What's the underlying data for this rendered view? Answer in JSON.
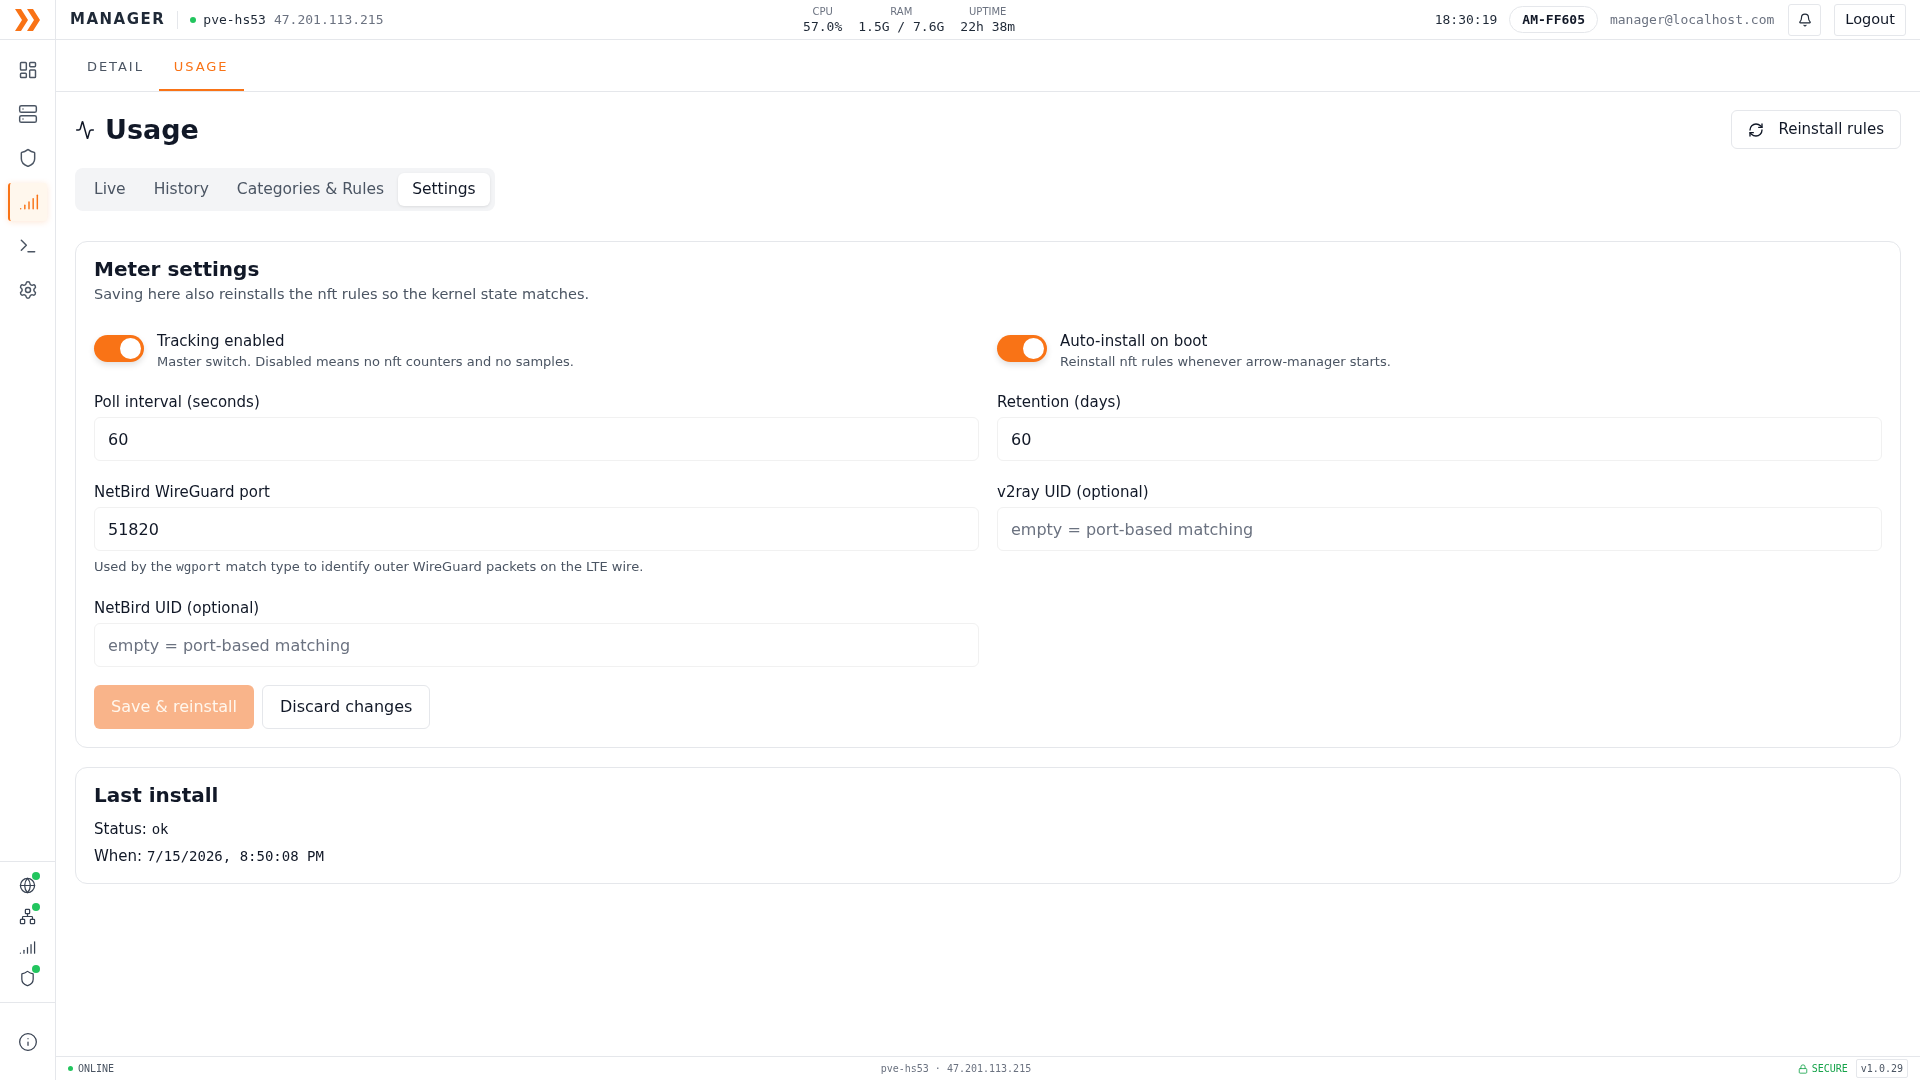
{
  "top_bar": {
    "app_name": "MANAGER",
    "host": {
      "name": "pve-hs53",
      "ip": "47.201.113.215",
      "online": true
    },
    "stats": [
      {
        "label": "CPU",
        "value": "57.0%"
      },
      {
        "label": "RAM",
        "value": "1.5G / 7.6G"
      },
      {
        "label": "UPTIME",
        "value": "22h 38m"
      }
    ],
    "clock": "18:30:19",
    "device_badge": "AM-FF605",
    "user_email": "manager@localhost.com",
    "logout_button": "Logout"
  },
  "sidebar": {
    "items": [
      {
        "selected": false
      },
      {
        "selected": false
      },
      {
        "selected": false
      },
      {
        "selected": true
      },
      {
        "selected": false
      },
      {
        "selected": false
      }
    ],
    "status_items": [
      {
        "online": true
      },
      {
        "online": true
      },
      {
        "online": false
      },
      {
        "online": true
      }
    ]
  },
  "page_tabs": [
    {
      "label": "DETAIL",
      "selected": false
    },
    {
      "label": "USAGE",
      "selected": true
    }
  ],
  "page": {
    "title": "Usage",
    "action_button": "Reinstall rules"
  },
  "view_tabs": [
    {
      "label": "Live",
      "selected": false
    },
    {
      "label": "History",
      "selected": false
    },
    {
      "label": "Categories & Rules",
      "selected": false
    },
    {
      "label": "Settings",
      "selected": true
    }
  ],
  "meter_settings": {
    "title": "Meter settings",
    "description": "Saving here also reinstalls the nft rules so the kernel state matches.",
    "toggles": [
      {
        "label": "Tracking enabled",
        "description": "Master switch. Disabled means no nft counters and no samples.",
        "on": true
      },
      {
        "label": "Auto-install on boot",
        "description": "Reinstall nft rules whenever arrow-manager starts.",
        "on": true
      }
    ],
    "fields": [
      {
        "label": "Poll interval (seconds)",
        "value": "60"
      },
      {
        "label": "Retention (days)",
        "value": "60"
      },
      {
        "label": "NetBird WireGuard port",
        "value": "51820",
        "help": [
          {
            "kind": "text",
            "text": "Used by the "
          },
          {
            "kind": "code",
            "text": "wgport"
          },
          {
            "kind": "text",
            "text": " match type to identify outer WireGuard packets on the LTE wire."
          }
        ]
      },
      {
        "label": "v2ray UID (optional)",
        "placeholder": "empty = port-based matching"
      },
      {
        "label": "NetBird UID (optional)",
        "placeholder": "empty = port-based matching"
      }
    ],
    "buttons": [
      {
        "label": "Save & reinstall",
        "kind": "primary",
        "disabled": true
      },
      {
        "label": "Discard changes",
        "kind": "secondary",
        "disabled": false
      }
    ]
  },
  "last_install": {
    "title": "Last install",
    "rows": [
      {
        "label": "Status:",
        "value": "ok"
      },
      {
        "label": "When:",
        "value": "7/15/2026, 8:50:08 PM"
      }
    ]
  },
  "status_bar": {
    "online": true,
    "connection": "ONLINE",
    "host": "pve-hs53 · 47.201.113.215",
    "security": "SECURE",
    "version": "v1.0.29"
  }
}
